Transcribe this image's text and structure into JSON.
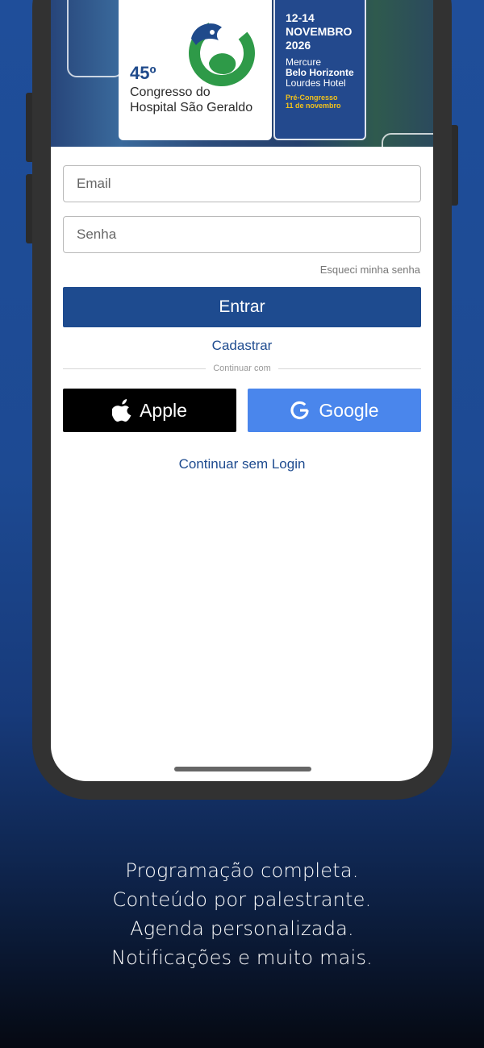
{
  "banner": {
    "ordinal": "45º",
    "congress_line1": "Congresso do",
    "congress_line2": "Hospital São Geraldo",
    "date_line1": "12-14",
    "date_line2": "NOVEMBRO",
    "date_line3": "2026",
    "venue_line1": "Mercure",
    "venue_line2": "Belo Horizonte",
    "venue_line3": "Lourdes Hotel",
    "pre_line1": "Pré-Congresso",
    "pre_line2": "11 de novembro",
    "colors": {
      "logo_blue": "#1f4a8b",
      "logo_green": "#2e9a48",
      "accent_yellow": "#f2c21b"
    }
  },
  "login": {
    "email_placeholder": "Email",
    "password_placeholder": "Senha",
    "forgot_label": "Esqueci minha senha",
    "submit_label": "Entrar",
    "register_label": "Cadastrar",
    "divider_label": "Continuar com",
    "apple_label": "Apple",
    "google_label": "Google",
    "guest_label": "Continuar sem Login",
    "primary_color": "#1e4b8f",
    "google_color": "#4a86ec",
    "apple_color": "#000000"
  },
  "tagline": {
    "line1": "Programação completa.",
    "line2": "Conteúdo por palestrante.",
    "line3": "Agenda personalizada.",
    "line4": "Notificações e muito mais."
  }
}
